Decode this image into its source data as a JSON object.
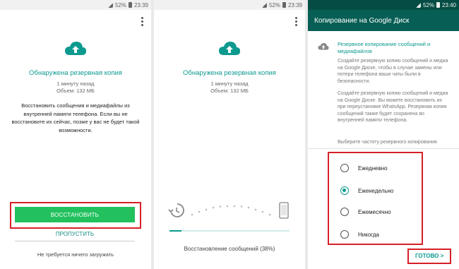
{
  "status_bar": {
    "left": {
      "battery": "52%",
      "time": "23:39"
    },
    "middle": {
      "battery": "52%",
      "time": "23:39"
    },
    "right": {
      "battery": "52%",
      "time": "23:40"
    }
  },
  "restore_screen": {
    "title": "Обнаружена резервная копия",
    "backup_age": "1 минуту назад",
    "backup_size": "Объем: 132 МБ",
    "description": "Восстановить сообщения и медиафайлы из внутренней памяти телефона. Если вы не восстановите их сейчас, позже у вас не будет такой возможности.",
    "restore_button": "ВОССТАНОВИТЬ",
    "skip_button": "ПРОПУСТИТЬ",
    "footer_note": "Не требуется ничего загружать",
    "icons": {
      "cloud": "cloud-upload-icon",
      "menu": "more-vert-icon"
    }
  },
  "progress_screen": {
    "progress": 0.1,
    "label": "Восстановление сообщений (38%)",
    "icons": {
      "history": "history-icon",
      "phone": "phone-icon"
    }
  },
  "gdrive_screen": {
    "header": "Копирование на Google Диск",
    "section_title": "Резервное копирование сообщений и медиафайлов",
    "para1": "Создайте резервную копию сообщений и медиа на Google Диске, чтобы в случае замены или потери телефона ваши чаты были в безопасности.",
    "para2": "Создайте резервную копию сообщений и медиа на Google Диске. Вы можете восстановить их при переустановке WhatsApp. Резервная копия сообщений также будет сохранена во внутренней памяти телефона.",
    "frequency_prompt": "Выберите частоту резервного копирования",
    "options": [
      {
        "label": "Ежедневно",
        "selected": false
      },
      {
        "label": "Еженедельно",
        "selected": true
      },
      {
        "label": "Ежемесячно",
        "selected": false
      },
      {
        "label": "Никогда",
        "selected": false
      }
    ],
    "done_button": "ГОТОВО >"
  },
  "colors": {
    "accent": "#0c9a8f",
    "header": "#075e54",
    "restore_green": "#22c15e",
    "highlight_red": "#d62027"
  }
}
